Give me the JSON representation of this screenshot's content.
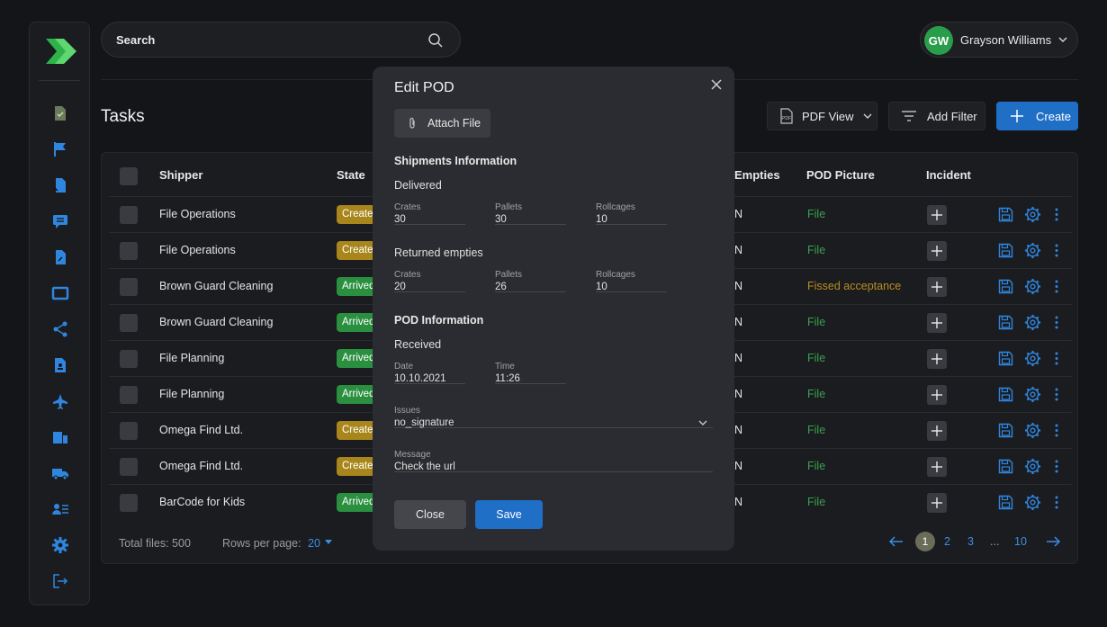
{
  "app": {
    "title": "Tasks"
  },
  "search": {
    "label": "Search"
  },
  "user": {
    "initials": "GW",
    "name": "Grayson Williams"
  },
  "sidebar": {
    "icons": [
      "document-check-icon",
      "flag-icon",
      "file-import-icon",
      "chat-transfer-icon",
      "file-export-icon",
      "monitor-icon",
      "share-icon",
      "contact-card-icon",
      "airplane-icon",
      "devices-icon",
      "truck-icon",
      "user-list-icon",
      "gear-icon",
      "logout-icon"
    ]
  },
  "toolbar": {
    "pdf_view": "PDF View",
    "add_filter": "Add Filter",
    "create": "Create"
  },
  "table": {
    "headers": {
      "shipper": "Shipper",
      "state": "State",
      "empties": "Empties",
      "pod_picture": "POD Picture",
      "incident": "Incident"
    },
    "rows": [
      {
        "shipper": "File Operations",
        "state": "Created",
        "state_color": "#a8861c",
        "empties": "N",
        "pod": "File",
        "pod_color": "#3aa14e"
      },
      {
        "shipper": "File Operations",
        "state": "Created",
        "state_color": "#a8861c",
        "empties": "N",
        "pod": "File",
        "pod_color": "#3aa14e"
      },
      {
        "shipper": "Brown Guard Cleaning",
        "state": "Arrived",
        "state_color": "#2a8f3f",
        "empties": "N",
        "pod": "Fissed acceptance",
        "pod_color": "#b88d1f"
      },
      {
        "shipper": "Brown Guard Cleaning",
        "state": "Arrived",
        "state_color": "#2a8f3f",
        "empties": "N",
        "pod": "File",
        "pod_color": "#3aa14e"
      },
      {
        "shipper": "File Planning",
        "state": "Arrived",
        "state_color": "#2a8f3f",
        "empties": "N",
        "pod": "File",
        "pod_color": "#3aa14e"
      },
      {
        "shipper": "File Planning",
        "state": "Arrived",
        "state_color": "#2a8f3f",
        "empties": "N",
        "pod": "File",
        "pod_color": "#3aa14e"
      },
      {
        "shipper": "Omega Find Ltd.",
        "state": "Created",
        "state_color": "#a8861c",
        "empties": "N",
        "pod": "File",
        "pod_color": "#3aa14e"
      },
      {
        "shipper": "Omega Find Ltd.",
        "state": "Created",
        "state_color": "#a8861c",
        "empties": "N",
        "pod": "File",
        "pod_color": "#3aa14e"
      },
      {
        "shipper": "BarCode for Kids",
        "state": "Arrived",
        "state_color": "#2a8f3f",
        "empties": "N",
        "pod": "File",
        "pod_color": "#3aa14e"
      }
    ]
  },
  "footer": {
    "total": "Total files: 500",
    "rows_label": "Rows per page:",
    "rows_value": "20",
    "pages": [
      "1",
      "2",
      "3",
      "...",
      "10"
    ]
  },
  "modal": {
    "title": "Edit POD",
    "attach": "Attach File",
    "shipments_title": "Shipments Information",
    "delivered": "Delivered",
    "delivered_fields": [
      {
        "label": "Crates",
        "value": "30"
      },
      {
        "label": "Pallets",
        "value": "30"
      },
      {
        "label": "Rollcages",
        "value": "10"
      }
    ],
    "returned": "Returned empties",
    "returned_fields": [
      {
        "label": "Crates",
        "value": "20"
      },
      {
        "label": "Pallets",
        "value": "26"
      },
      {
        "label": "Rollcages",
        "value": "10"
      }
    ],
    "pod_title": "POD Information",
    "received": "Received",
    "date_label": "Date",
    "date_value": "10.10.2021",
    "time_label": "Time",
    "time_value": "11:26",
    "issues_label": "Issues",
    "issues_value": "no_signature",
    "message_label": "Message",
    "message_value": "Check the url",
    "close": "Close",
    "save": "Save"
  },
  "colors": {
    "accent": "#1f6fc7",
    "brand": "#2db34a"
  }
}
